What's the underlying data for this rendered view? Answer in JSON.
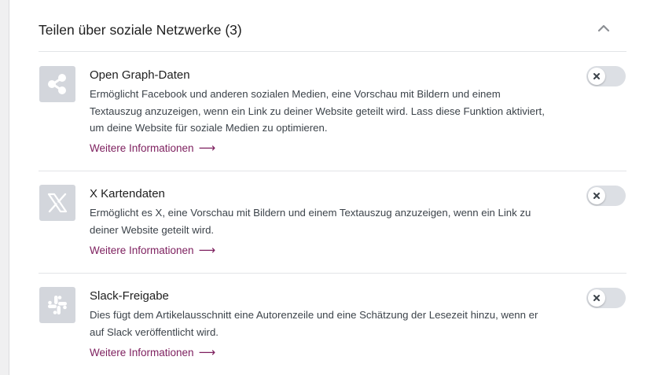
{
  "section": {
    "title": "Teilen über soziale Netzwerke (3)"
  },
  "features": [
    {
      "title": "Open Graph-Daten",
      "description": "Ermöglicht Facebook und anderen sozialen Medien, eine Vorschau mit Bildern und einem Textauszug anzuzeigen, wenn ein Link zu deiner Website geteilt wird. Lass diese Funktion aktiviert, um deine Website für soziale Medien zu optimieren.",
      "link": "Weitere Informationen",
      "icon": "share-icon",
      "enabled": false
    },
    {
      "title": "X Kartendaten",
      "description": "Ermöglicht es X, eine Vorschau mit Bildern und einem Textauszug anzuzeigen, wenn ein Link zu deiner Website geteilt wird.",
      "link": "Weitere Informationen",
      "icon": "x-logo-icon",
      "enabled": false
    },
    {
      "title": "Slack-Freigabe",
      "description": "Dies fügt dem Artikelausschnitt eine Autorenzeile und eine Schätzung der Lesezeit hinzu, wenn er auf Slack veröffentlicht wird.",
      "link": "Weitere Informationen",
      "icon": "slack-icon",
      "enabled": false
    }
  ],
  "colors": {
    "link": "#7d1f5e",
    "icon_bg": "#d3d6dc",
    "toggle_off": "#dcdfe4"
  }
}
